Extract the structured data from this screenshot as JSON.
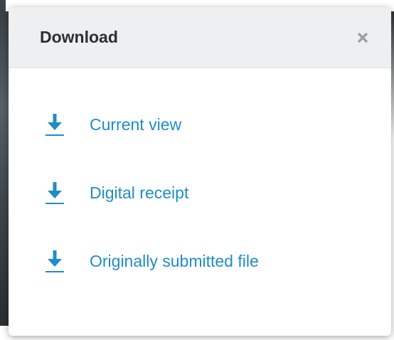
{
  "dialog": {
    "title": "Download",
    "close_icon": "close-icon",
    "options": [
      {
        "label": "Current view",
        "icon": "download-icon"
      },
      {
        "label": "Digital receipt",
        "icon": "download-icon"
      },
      {
        "label": "Originally submitted file",
        "icon": "download-icon"
      }
    ]
  },
  "colors": {
    "accent": "#1f8dc7",
    "header_bg": "#eeeff1",
    "title_text": "#2b2f33",
    "close_icon": "#9aa0a6"
  }
}
